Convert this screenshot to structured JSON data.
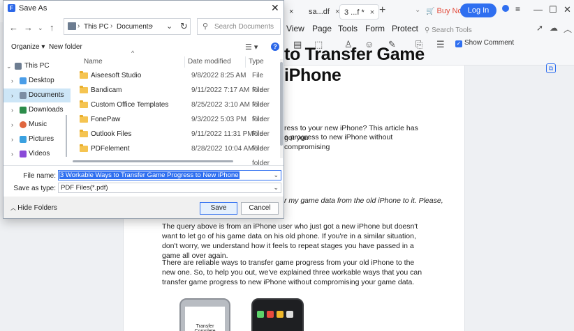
{
  "app": {
    "tabs": [
      {
        "label": "sa...df"
      },
      {
        "label": "3 ...f *"
      }
    ],
    "tab_close": "×",
    "new_tab": "+",
    "buy_now": "Buy Now",
    "login": "Log In",
    "window_controls": {
      "minimize": "—",
      "maximize": "☐",
      "close": "✕"
    },
    "menu": [
      "View",
      "Page",
      "Tools",
      "Form",
      "Protect"
    ],
    "search_tools_placeholder": "Search Tools",
    "show_comment": "Show Comment",
    "document": {
      "title_line1": "to Transfer Game",
      "title_line2": "iPhone",
      "para_intro_1": "ress to your new iPhone? This article has got you",
      "para_intro_2": "e progress to new iPhone without compromising",
      "quote": "r my game data from the old iPhone to it. Please,",
      "para2": "The query above is from an iPhone user who just got a new iPhone but doesn't want to let go of his game data on his old phone. If you're in a similar situation, don't worry, we understand how it feels to repeat stages you have passed in a game all over again.",
      "para3": "There are reliable ways to transfer game progress from your old iPhone to the new one. So, to help you out, we've explained three workable ways that you can transfer game progress to new iPhone without compromising your game data.",
      "phone_caption": "Transfer Complete"
    }
  },
  "dialog": {
    "title": "Save As",
    "close_icon": "✕",
    "address": {
      "crumbs": [
        "This PC",
        "Documents"
      ]
    },
    "search_placeholder": "Search Documents",
    "organize": "Organize ▾",
    "new_folder": "New folder",
    "help": "?",
    "nav": [
      {
        "label": "This PC",
        "icon_color": "#6d7d91",
        "expanded": true,
        "level": 0
      },
      {
        "label": "Desktop",
        "icon_color": "#4a9de8",
        "level": 1
      },
      {
        "label": "Documents",
        "icon_color": "#7c8da3",
        "level": 1,
        "selected": true
      },
      {
        "label": "Downloads",
        "icon_color": "#2c8c4a",
        "level": 1
      },
      {
        "label": "Music",
        "icon_color": "#e0673f",
        "level": 1
      },
      {
        "label": "Pictures",
        "icon_color": "#3aa1e0",
        "level": 1
      },
      {
        "label": "Videos",
        "icon_color": "#8a4ad8",
        "level": 1
      }
    ],
    "columns": {
      "name": "Name",
      "date": "Date modified",
      "type": "Type"
    },
    "files": [
      {
        "name": "Aiseesoft Studio",
        "date": "9/8/2022 8:25 AM",
        "type": "File folder"
      },
      {
        "name": "Bandicam",
        "date": "9/11/2022 7:17 AM",
        "type": "File folder"
      },
      {
        "name": "Custom Office Templates",
        "date": "8/25/2022 3:10 AM",
        "type": "File folder"
      },
      {
        "name": "FonePaw",
        "date": "9/3/2022 5:03 PM",
        "type": "File folder"
      },
      {
        "name": "Outlook Files",
        "date": "9/11/2022 11:31 PM",
        "type": "File folder"
      },
      {
        "name": "PDFelement",
        "date": "8/28/2022 10:04 AM",
        "type": "File folder"
      }
    ],
    "file_name_label": "File name:",
    "file_name_value": "3 Workable Ways to Transfer Game Progress to New iPhone",
    "save_as_type_label": "Save as type:",
    "save_as_type_value": "PDF Files(*.pdf)",
    "hide_folders": "Hide Folders",
    "save": "Save",
    "cancel": "Cancel"
  }
}
